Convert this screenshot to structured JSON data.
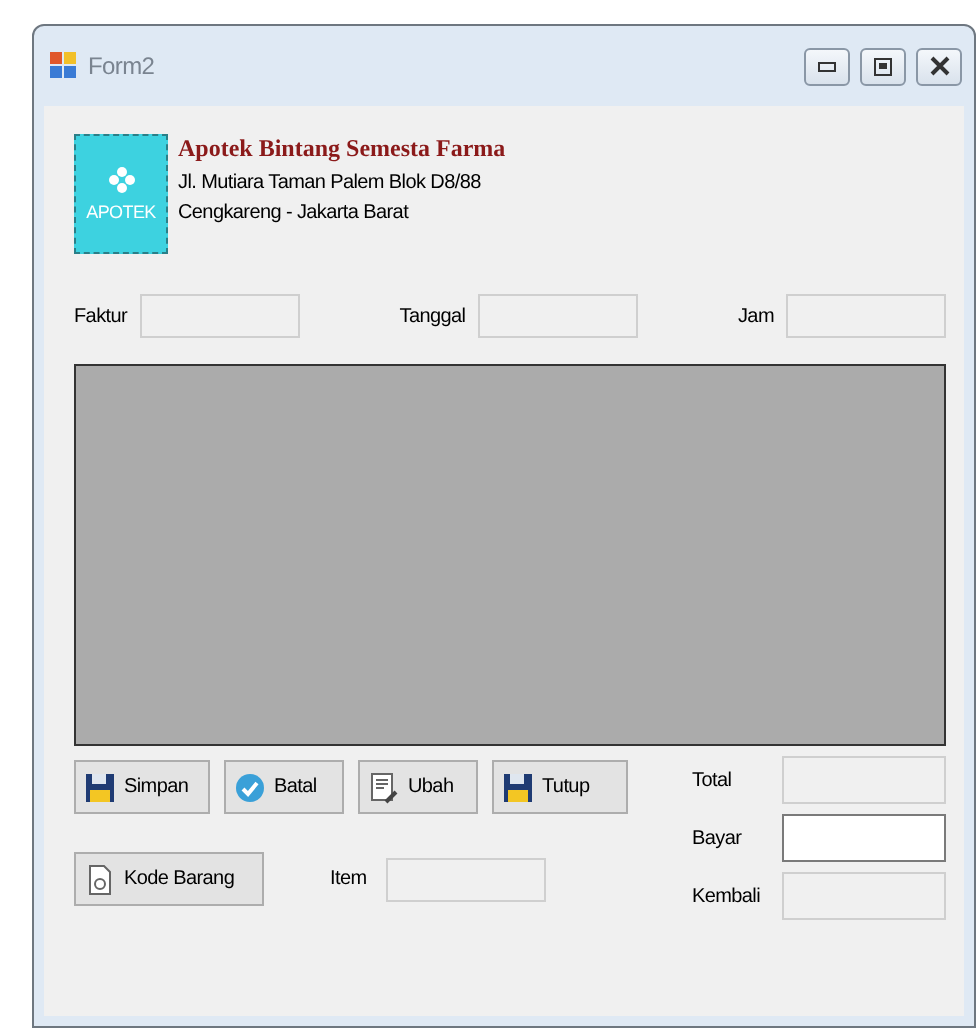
{
  "window": {
    "title": "Form2"
  },
  "header": {
    "logo_text": "APOTEK",
    "name": "Apotek Bintang Semesta Farma",
    "address_lines": [
      "Jl. Mutiara Taman Palem Blok D8/88",
      "Cengkareng - Jakarta Barat"
    ]
  },
  "top_fields": [
    {
      "label": "Faktur",
      "disabled": true
    },
    {
      "label": "Tanggal",
      "disabled": true
    },
    {
      "label": "Jam",
      "disabled": true
    }
  ],
  "actions": [
    {
      "label": "Simpan",
      "kind": "floppy"
    },
    {
      "label": "Batal",
      "kind": "check"
    },
    {
      "label": "Ubah",
      "kind": "edit"
    },
    {
      "label": "Tutup",
      "kind": "floppy"
    }
  ],
  "lookup": {
    "button": {
      "label": "Kode Barang",
      "kind": "document"
    },
    "field": {
      "label": "Item",
      "disabled": true
    }
  },
  "totals": [
    {
      "label": "Total",
      "disabled": true
    },
    {
      "label": "Bayar",
      "disabled": false
    },
    {
      "label": "Kembali",
      "disabled": true
    }
  ]
}
